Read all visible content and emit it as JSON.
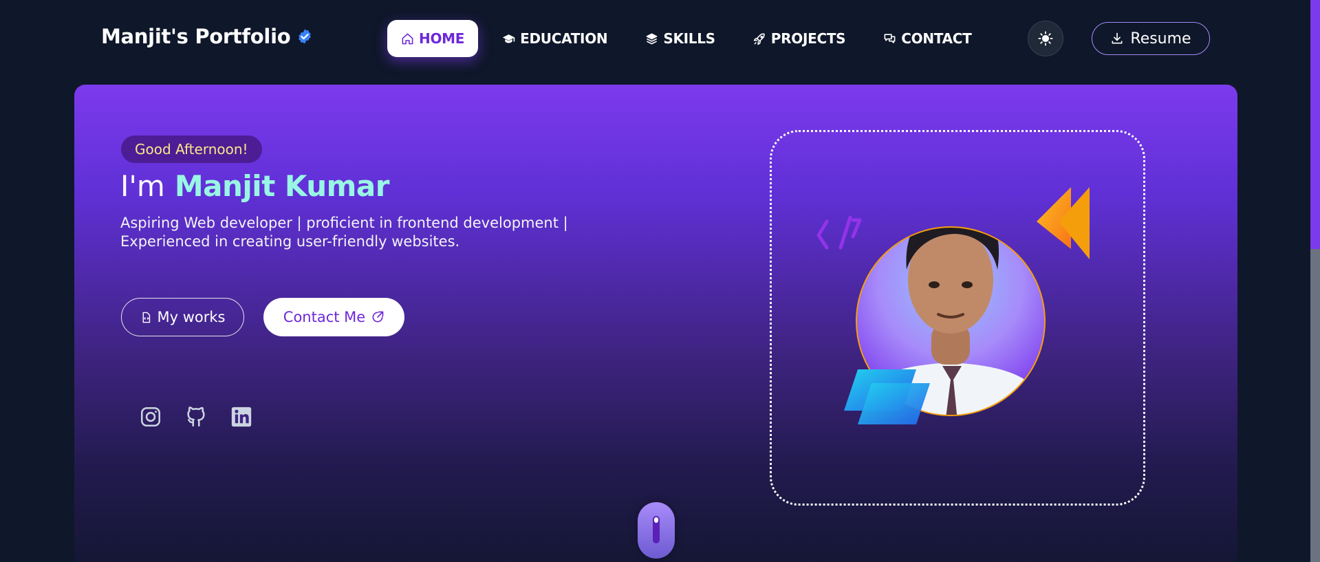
{
  "brand": {
    "title": "Manjit's Portfolio",
    "verified_icon": "verified-badge-icon"
  },
  "nav": {
    "items": [
      {
        "label": "HOME",
        "icon": "home-icon",
        "active": true
      },
      {
        "label": "EDUCATION",
        "icon": "graduation-cap-icon",
        "active": false
      },
      {
        "label": "SKILLS",
        "icon": "layers-icon",
        "active": false
      },
      {
        "label": "PROJECTS",
        "icon": "rocket-icon",
        "active": false
      },
      {
        "label": "CONTACT",
        "icon": "chat-icon",
        "active": false
      }
    ]
  },
  "header": {
    "theme_icon": "sun-icon",
    "resume_label": "Resume",
    "resume_icon": "download-icon"
  },
  "hero": {
    "greeting": "Good Afternoon!",
    "intro_prefix": "I'm",
    "name": "Manjit Kumar",
    "tagline": "Aspiring Web developer | proficient in frontend development | Experienced in creating user-friendly websites.",
    "works_label": "My works",
    "contact_label": "Contact Me",
    "socials": [
      "instagram-icon",
      "github-icon",
      "linkedin-icon"
    ]
  },
  "colors": {
    "background": "#0f172a",
    "accent": "#7c3aed",
    "name_highlight": "#99f6e4",
    "greeting_text": "#fde68a"
  }
}
